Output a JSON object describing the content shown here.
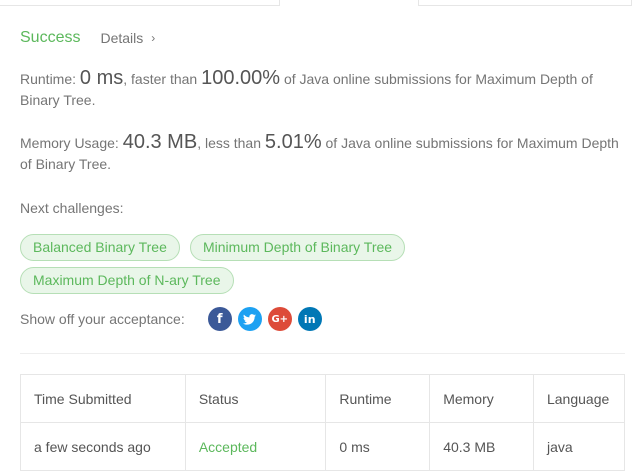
{
  "header": {
    "status": "Success",
    "details_label": "Details"
  },
  "runtime": {
    "label": "Runtime: ",
    "value": "0 ms",
    "mid": ", faster than ",
    "percent": "100.00%",
    "suffix": " of Java online submissions for Maximum Depth of Binary Tree."
  },
  "memory": {
    "label": "Memory Usage: ",
    "value": "40.3 MB",
    "mid": ", less than ",
    "percent": "5.01%",
    "suffix": " of Java online submissions for Maximum Depth of Binary Tree."
  },
  "next": {
    "label": "Next challenges:",
    "challenges": [
      "Balanced Binary Tree",
      "Minimum Depth of Binary Tree",
      "Maximum Depth of N-ary Tree"
    ]
  },
  "share": {
    "label": "Show off your acceptance:",
    "icons": [
      "facebook-icon",
      "twitter-icon",
      "google-plus-icon",
      "linkedin-icon"
    ]
  },
  "table": {
    "headers": [
      "Time Submitted",
      "Status",
      "Runtime",
      "Memory",
      "Language"
    ],
    "rows": [
      [
        "a few seconds ago",
        "Accepted",
        "0 ms",
        "40.3 MB",
        "java"
      ]
    ]
  },
  "colors": {
    "success": "#5cb85c",
    "chip_bg": "#e9f6e9",
    "text": "#757575"
  }
}
